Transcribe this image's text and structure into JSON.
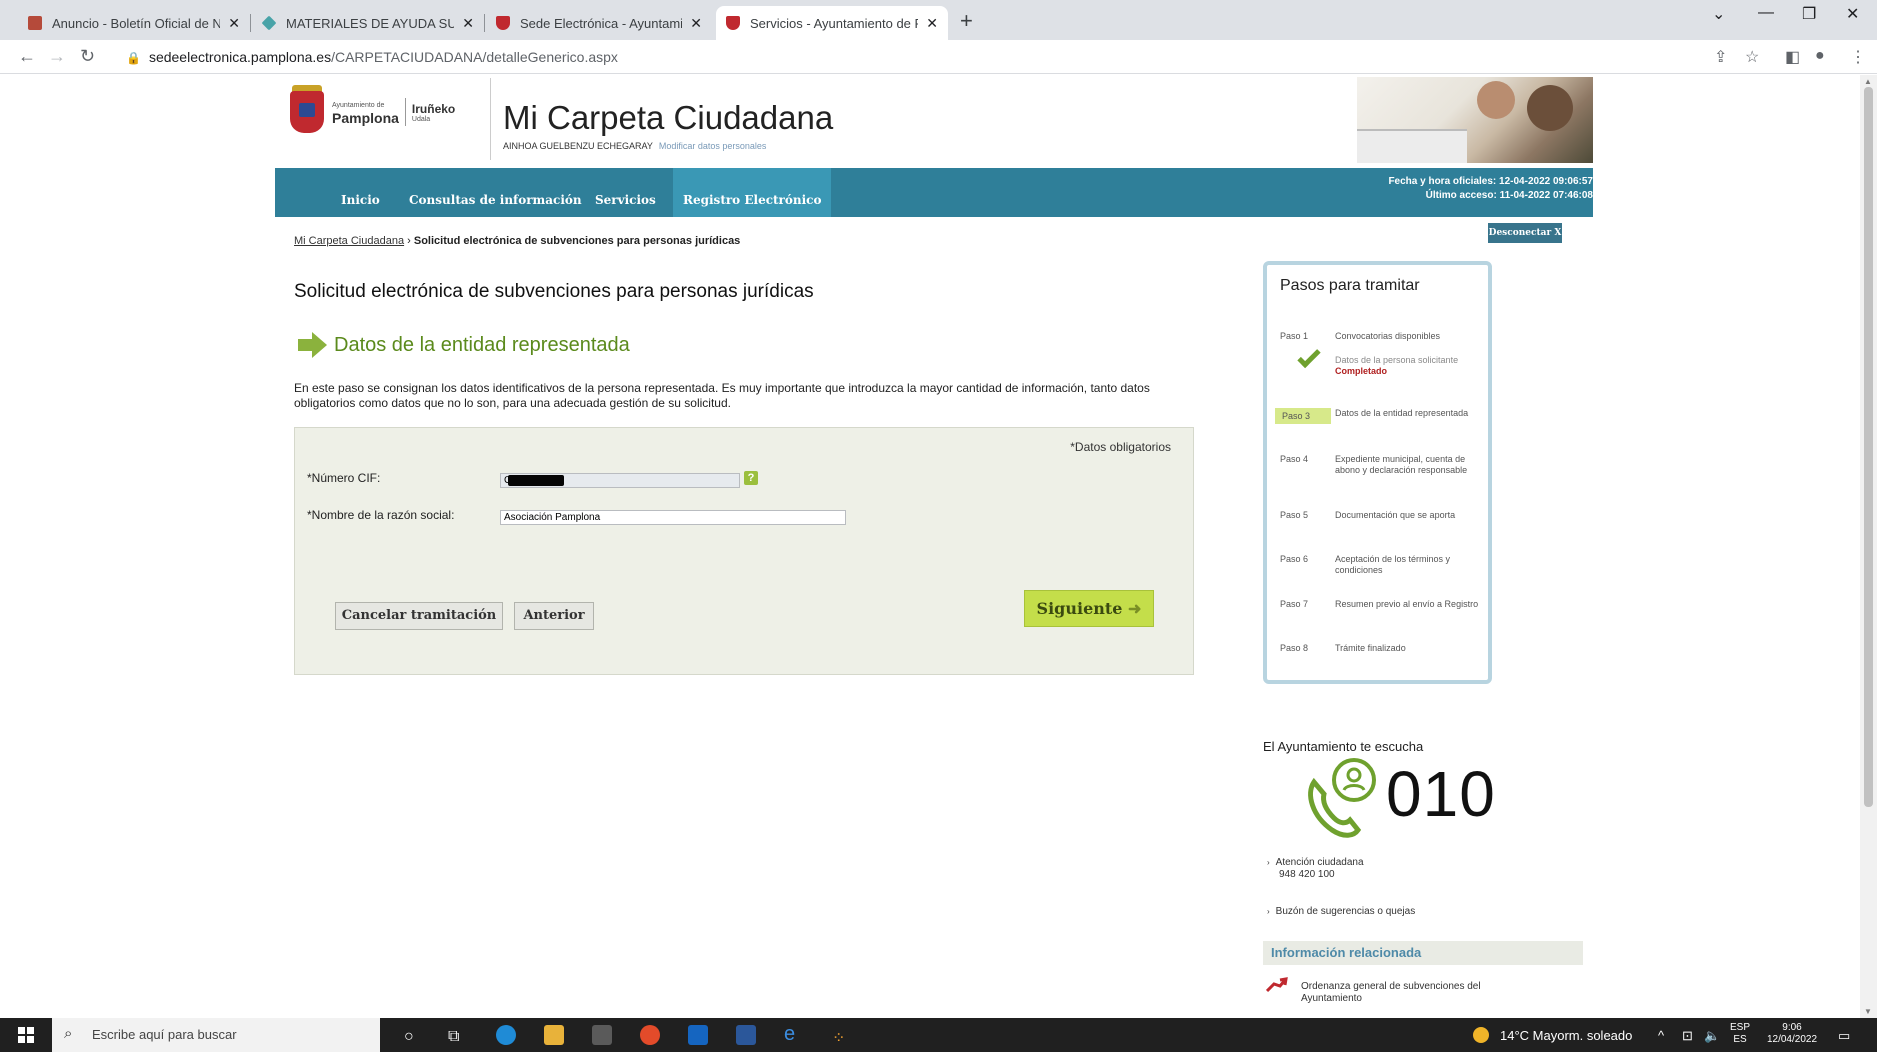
{
  "browser": {
    "tabs": [
      {
        "label": "Anuncio - Boletín Oficial de Nav",
        "icon": "document-icon"
      },
      {
        "label": "MATERIALES DE AYUDA SUBVEN",
        "icon": "diamond-icon"
      },
      {
        "label": "Sede Electrónica - Ayuntamiento",
        "icon": "shield-icon"
      },
      {
        "label": "Servicios - Ayuntamiento de Pam",
        "icon": "shield-icon"
      }
    ],
    "url_domain": "sedeelectronica.pamplona.es",
    "url_path": "/CARPETACIUDADANA/detalleGenerico.aspx"
  },
  "header": {
    "logo_ayto_small": "Ayuntamiento de",
    "logo_ayto": "Pamplona",
    "logo_eus": "Iruñeko",
    "logo_eus_small": "Udala",
    "title": "Mi Carpeta Ciudadana",
    "user_name": "AINHOA GUELBENZU ECHEGARAY",
    "modify_link": "Modificar datos personales"
  },
  "nav": {
    "items": [
      "Inicio",
      "Consultas de información",
      "Servicios",
      "Registro Electrónico"
    ],
    "official_time": "Fecha y hora oficiales: 12-04-2022 09:06:57",
    "last_access": "Último acceso: 11-04-2022 07:46:08",
    "logout": "Desconectar X"
  },
  "breadcrumb": {
    "home": "Mi Carpeta Ciudadana",
    "separator": " › ",
    "current": "Solicitud electrónica de subvenciones para personas jurídicas"
  },
  "main": {
    "title": "Solicitud electrónica de subvenciones para personas jurídicas",
    "section_title": "Datos de la entidad representada",
    "intro": "En este paso se consignan los datos identificativos de la persona representada. Es muy importante que introduzca la mayor cantidad de información, tanto datos obligatorios como datos que no lo son, para una adecuada gestión de su solicitud.",
    "required_note": "*Datos obligatorios",
    "fields": {
      "cif_label": "*Número CIF:",
      "cif_value": "G",
      "name_label": "*Nombre de la razón social:",
      "name_value": "Asociación Pamplona"
    },
    "help": "?",
    "buttons": {
      "cancel": "Cancelar tramitación",
      "previous": "Anterior",
      "next": "Siguiente",
      "next_arrow": "➜"
    }
  },
  "steps": {
    "title": "Pasos para tramitar",
    "items": [
      {
        "no": "Paso 1",
        "desc": "Convocatorias disponibles"
      },
      {
        "no": "",
        "desc": "Datos de la persona solicitante",
        "status": "Completado"
      },
      {
        "no": "Paso 3",
        "desc": "Datos de la entidad representada"
      },
      {
        "no": "Paso 4",
        "desc": "Expediente municipal, cuenta de abono y declaración responsable"
      },
      {
        "no": "Paso 5",
        "desc": "Documentación que se aporta"
      },
      {
        "no": "Paso 6",
        "desc": "Aceptación de los términos y condiciones"
      },
      {
        "no": "Paso 7",
        "desc": "Resumen previo al envío a Registro"
      },
      {
        "no": "Paso 8",
        "desc": "Trámite finalizado"
      }
    ]
  },
  "sidebar": {
    "listen_title": "El Ayuntamiento te escucha",
    "phone_number": "010",
    "attention_label": "Atención ciudadana",
    "attention_phone": "948 420 100",
    "suggestions": "Buzón de sugerencias o quejas",
    "related_title": "Información relacionada",
    "related_link": "Ordenanza general de subvenciones del Ayuntamiento"
  },
  "taskbar": {
    "search_placeholder": "Escribe aquí para buscar",
    "weather": "14°C  Mayorm. soleado",
    "lang_top": "ESP",
    "lang_bottom": "ES",
    "time": "9:06",
    "date": "12/04/2022"
  },
  "colors": {
    "nav_bg": "#2f7f99",
    "accent_green": "#8bb23d",
    "next_button": "#c4de4a",
    "form_bg": "#eef0e7"
  }
}
